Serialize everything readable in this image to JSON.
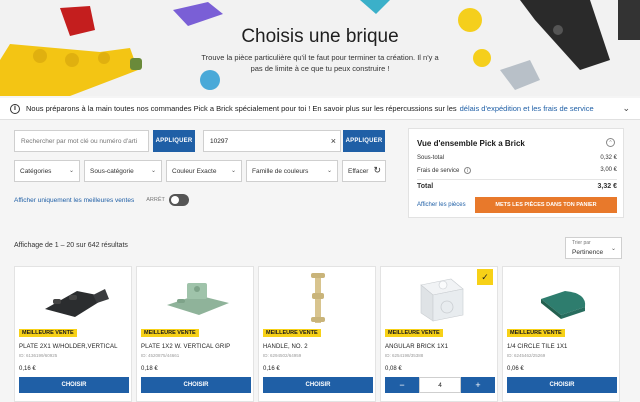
{
  "hero": {
    "title": "Choisis une brique",
    "subtitle": "Trouve la pièce particulière qu'il te faut pour terminer ta création. Il n'y a pas de limite à ce que tu peux construire !"
  },
  "notice": {
    "text": "Nous préparons à la main toutes nos commandes Pick a Brick spécialement pour toi ! En savoir plus sur les répercussions sur les",
    "link_text": "délais d'expédition et les frais de service",
    "icon": "info-icon"
  },
  "search": {
    "keyword_placeholder": "Rechercher par mot clé ou numéro d'arti",
    "apply_label_1": "APPLIQUER",
    "set_value": "10297",
    "apply_label_2": "APPLIQUER"
  },
  "filters": {
    "categories": "Catégories",
    "subcategory": "Sous-catégorie",
    "exact_color": "Couleur Exacte",
    "color_family": "Famille de couleurs",
    "clear": "Effacer"
  },
  "best_sellers_toggle": {
    "label": "Afficher uniquement les meilleures ventes",
    "state": "ARRÊT"
  },
  "overview": {
    "title": "Vue d'ensemble Pick a Brick",
    "subtotal_label": "Sous-total",
    "subtotal_value": "0,32 €",
    "service_label": "Frais de service",
    "service_value": "3,00 €",
    "total_label": "Total",
    "total_value": "3,32 €",
    "show_pieces": "Afficher les pièces",
    "cart_button": "METS LES PIÈCES DANS TON PANIER"
  },
  "results": {
    "count_text": "Affichage de 1 – 20 sur 642 résultats",
    "sort_label": "Trier par",
    "sort_value": "Pertinence"
  },
  "products": [
    {
      "badge": "MEILLEURE VENTE",
      "name": "PLATE 2X1 W/HOLDER,VERTICAL",
      "id": "ID: 6136199/60925",
      "price": "0,16 €",
      "action": "CHOISIR",
      "color": "#2b2d2f"
    },
    {
      "badge": "MEILLEURE VENTE",
      "name": "PLATE 1X2 W. VERTICAL GRIP",
      "id": "ID: 4520875/44661",
      "price": "0,18 €",
      "action": "CHOISIR",
      "color": "#8fb39a"
    },
    {
      "badge": "MEILLEURE VENTE",
      "name": "HANDLE, NO. 2",
      "id": "ID: 6294502/64959",
      "price": "0,16 €",
      "action": "CHOISIR",
      "color": "#d8c48e"
    },
    {
      "badge": "MEILLEURE VENTE",
      "name": "ANGULAR BRICK 1X1",
      "id": "ID: 6254198/35388",
      "price": "0,08 €",
      "action": "",
      "quantity": "4",
      "color": "#e8ecef"
    },
    {
      "badge": "MEILLEURE VENTE",
      "name": "1/4 CIRCLE TILE 1X1",
      "id": "ID: 6245462/25269",
      "price": "0,06 €",
      "action": "CHOISIR",
      "color": "#2e7d6e"
    }
  ]
}
